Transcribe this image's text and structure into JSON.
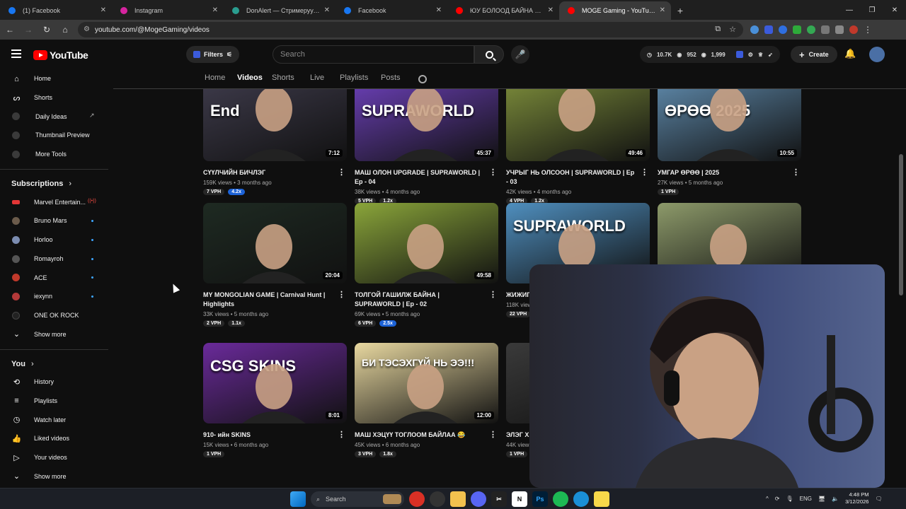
{
  "browser": {
    "tabs": [
      {
        "title": "(1) Facebook",
        "color": "#1877f2",
        "active": false
      },
      {
        "title": "Instagram",
        "color": "#d6249f",
        "active": false
      },
      {
        "title": "DonAlert — Стримеруудэд зор",
        "color": "#2a9d8f",
        "active": false
      },
      {
        "title": "Facebook",
        "color": "#1877f2",
        "active": false
      },
      {
        "title": "ЮУ БОЛООД БАЙНА АА - You",
        "color": "#ff0000",
        "active": false
      },
      {
        "title": "MOGE Gaming - YouTube",
        "color": "#ff0000",
        "active": true
      }
    ],
    "url": "youtube.com/@MogeGaming/videos"
  },
  "header": {
    "logo_text": "YouTube",
    "filters_label": "Filters",
    "search_placeholder": "Search",
    "stats": {
      "views": "10.7K",
      "likes": "952",
      "watching": "1,999"
    },
    "create_label": "Create"
  },
  "sidebar": {
    "main": [
      {
        "label": "Home",
        "icon": "home-icon"
      },
      {
        "label": "Shorts",
        "icon": "shorts-icon"
      },
      {
        "label": "Daily Ideas",
        "icon": "ideas-icon"
      },
      {
        "label": "Thumbnail Preview",
        "icon": "preview-icon"
      },
      {
        "label": "More Tools",
        "icon": "tools-icon"
      }
    ],
    "subscriptions_title": "Subscriptions",
    "subscriptions": [
      {
        "label": "Marvel Entertain...",
        "color": "#e23636",
        "status": "live"
      },
      {
        "label": "Bruno Mars",
        "color": "#6b5b4b",
        "status": "new"
      },
      {
        "label": "Horloo",
        "color": "#7b8cb0",
        "status": "new"
      },
      {
        "label": "Romayroh",
        "color": "#555555",
        "status": "new"
      },
      {
        "label": "ACE",
        "color": "#c0392b",
        "status": "new"
      },
      {
        "label": "iexynn",
        "color": "#b33939",
        "status": "new"
      },
      {
        "label": "ONE OK ROCK",
        "color": "#222222",
        "status": "none"
      }
    ],
    "show_more_label": "Show more",
    "you_title": "You",
    "you": [
      {
        "label": "History",
        "icon": "history-icon"
      },
      {
        "label": "Playlists",
        "icon": "playlists-icon"
      },
      {
        "label": "Watch later",
        "icon": "watch-later-icon"
      },
      {
        "label": "Liked videos",
        "icon": "like-icon"
      },
      {
        "label": "Your videos",
        "icon": "your-videos-icon"
      }
    ],
    "you_show_more_label": "Show more"
  },
  "channel_tabs": [
    "Home",
    "Videos",
    "Shorts",
    "Live",
    "Playlists",
    "Posts"
  ],
  "videos": [
    {
      "title": "СҮҮЛЧИЙН БИЧЛЭГ",
      "views": "159K views",
      "age": "3 months ago",
      "duration": "7:12",
      "vph": "7 VPH",
      "mult": "4.2x",
      "mult_blue": true,
      "overlay": "End",
      "bg": "#3d3a4a"
    },
    {
      "title": "МАШ ОЛОН UPGRADE | SUPRAWORLD | Ep - 04",
      "views": "38K views",
      "age": "4 months ago",
      "duration": "45:37",
      "vph": "5 VPH",
      "mult": "1.2x",
      "mult_blue": false,
      "overlay": "SUPRAWORLD",
      "bg": "#6a3fb5"
    },
    {
      "title": "УЧРЫГ НЬ ОЛСООН | SUPRAWORLD | Ep - 03",
      "views": "42K views",
      "age": "4 months ago",
      "duration": "49:46",
      "vph": "4 VPH",
      "mult": "1.2x",
      "mult_blue": false,
      "overlay": "",
      "bg": "#7a8a3a"
    },
    {
      "title": "УМГАР ӨРӨӨ | 2025",
      "views": "27K views",
      "age": "5 months ago",
      "duration": "10:55",
      "vph": "1 VPH",
      "mult": "",
      "mult_blue": false,
      "overlay": "ӨРӨӨ 2025",
      "bg": "#5d87a8"
    },
    {
      "title": "MY MONGOLIAN GAME | Carnival Hunt | Highlights",
      "views": "33K views",
      "age": "5 months ago",
      "duration": "20:04",
      "vph": "2 VPH",
      "mult": "1.1x",
      "mult_blue": false,
      "overlay": "",
      "bg": "#1e2a22"
    },
    {
      "title": "ТОЛГОЙ ГАШИЛЖ БАЙНА | SUPRAWORLD | Ep - 02",
      "views": "69K views",
      "age": "5 months ago",
      "duration": "49:58",
      "vph": "6 VPH",
      "mult": "2.5x",
      "mult_blue": true,
      "overlay": "",
      "bg": "#8aa53a"
    },
    {
      "title": "ЖИЖИГ SUPRA",
      "views": "118K views",
      "age": "",
      "duration": "",
      "vph": "22 VPH",
      "mult": "",
      "mult_blue": false,
      "overlay": "SUPRAWORLD",
      "bg": "#4f8fbf"
    },
    {
      "title": "",
      "views": "",
      "age": "",
      "duration": "",
      "vph": "",
      "mult": "",
      "mult_blue": false,
      "overlay": "",
      "bg": "#8d9a6a"
    },
    {
      "title": "910- ийн SKINS",
      "views": "15K views",
      "age": "6 months ago",
      "duration": "8:01",
      "vph": "1 VPH",
      "mult": "",
      "mult_blue": false,
      "overlay": "CSG SKINS",
      "bg": "#6a2a9a"
    },
    {
      "title": "МАШ ХЭЦҮҮ ТОГЛООМ БАЙЛАА 😂",
      "views": "45K views",
      "age": "6 months ago",
      "duration": "12:00",
      "vph": "3 VPH",
      "mult": "1.8x",
      "mult_blue": false,
      "overlay": "БИ ТЭСЭХГҮЙ НЬ ЭЭ!!!",
      "bg": "#e8d8a0"
    },
    {
      "title": "ЭЛЭГ Х",
      "views": "44K views",
      "age": "",
      "duration": "",
      "vph": "1 VPH",
      "mult": "",
      "mult_blue": false,
      "overlay": "",
      "bg": "#3a3a3a"
    }
  ],
  "taskbar": {
    "search_label": "Search",
    "lang": "ENG",
    "time": "4:48 PM",
    "date": "3/12/2026"
  }
}
